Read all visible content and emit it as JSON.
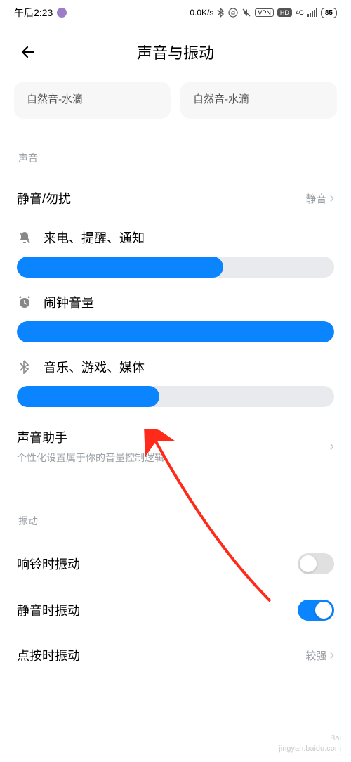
{
  "status": {
    "time": "午后2:23",
    "speed": "0.0K/s",
    "vpn": "VPN",
    "hd": "HD",
    "network": "4G",
    "battery": "85"
  },
  "header": {
    "title": "声音与振动"
  },
  "chips": {
    "left": "自然音-水滴",
    "right": "自然音-水滴"
  },
  "sections": {
    "sound_label": "声音",
    "vibration_label": "振动"
  },
  "silent_dnd": {
    "title": "静音/勿扰",
    "value": "静音"
  },
  "sliders": {
    "notification": {
      "label": "来电、提醒、通知",
      "percent": 65
    },
    "alarm": {
      "label": "闹钟音量",
      "percent": 100
    },
    "media": {
      "label": "音乐、游戏、媒体",
      "percent": 45
    }
  },
  "sound_assistant": {
    "title": "声音助手",
    "subtitle": "个性化设置属于你的音量控制逻辑"
  },
  "toggles": {
    "ring_vibrate": {
      "label": "响铃时振动",
      "on": false
    },
    "silent_vibrate": {
      "label": "静音时振动",
      "on": true
    },
    "tap_vibrate_label": "点按时振动",
    "tap_vibrate_value": "较强"
  },
  "watermark": {
    "line1": "Bai",
    "line2": "jingyan.baidu.com"
  }
}
